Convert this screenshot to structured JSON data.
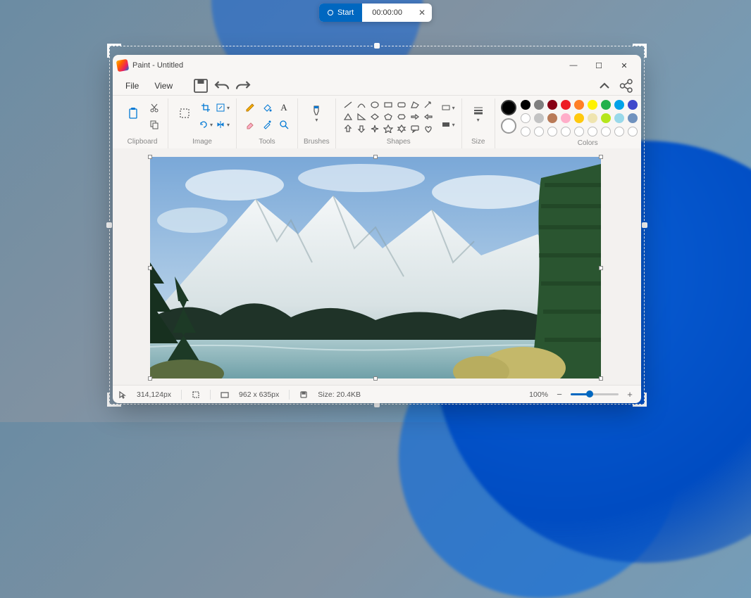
{
  "recorder": {
    "start_label": "Start",
    "time": "00:00:00"
  },
  "window": {
    "title": "Paint - Untitled",
    "menu": {
      "file": "File",
      "view": "View"
    }
  },
  "ribbon": {
    "clipboard_label": "Clipboard",
    "image_label": "Image",
    "tools_label": "Tools",
    "brushes_label": "Brushes",
    "shapes_label": "Shapes",
    "size_label": "Size",
    "colors_label": "Colors"
  },
  "colors": {
    "row1": [
      "#000000",
      "#7f7f7f",
      "#880015",
      "#ed1c24",
      "#ff7f27",
      "#fff200",
      "#22b14c",
      "#00a2e8",
      "#3f48cc",
      "#a349a4"
    ],
    "row2": [
      "#ffffff",
      "#c3c3c3",
      "#b97a57",
      "#ffaec9",
      "#ffc90e",
      "#efe4b0",
      "#b5e61d",
      "#99d9ea",
      "#7092be",
      "#c8bfe7"
    ]
  },
  "status": {
    "cursor": "314,124px",
    "canvas_size": "962  x  635px",
    "file_size": "Size: 20.4KB",
    "zoom": "100%"
  }
}
